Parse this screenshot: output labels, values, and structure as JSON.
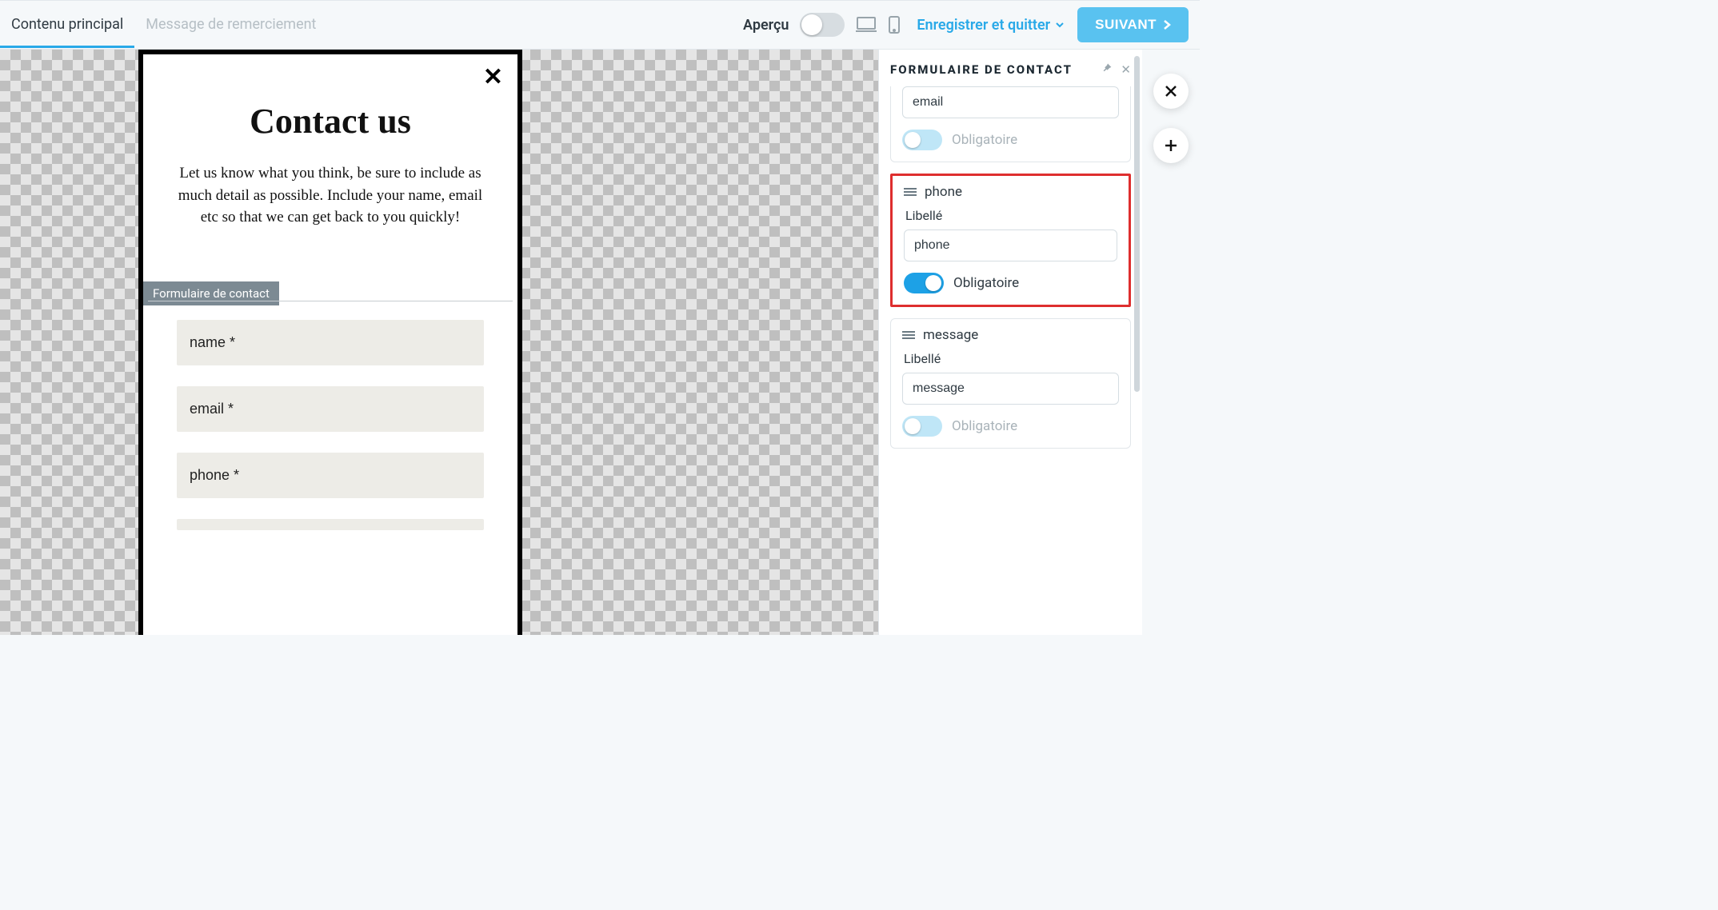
{
  "topbar": {
    "tab_main": "Contenu principal",
    "tab_thanks": "Message de remerciement",
    "preview_label": "Aperçu",
    "save_exit": "Enregistrer et quitter",
    "next": "SUIVANT"
  },
  "popup": {
    "title": "Contact us",
    "description": "Let us know what you think, be sure to include as much detail as possible. Include your name, email etc so that we can get back to you quickly!",
    "block_label": "Formulaire de contact",
    "fields": {
      "name": "name *",
      "email": "email *",
      "phone": "phone *"
    }
  },
  "panel": {
    "title": "Formulaire de contact",
    "label_libelle": "Libellé",
    "label_oblig": "Obligatoire",
    "field_email": {
      "name": "email",
      "value": "email",
      "required_on": false
    },
    "field_phone": {
      "name": "phone",
      "value": "phone",
      "required_on": true
    },
    "field_message": {
      "name": "message",
      "value": "message",
      "required_on": false
    }
  }
}
